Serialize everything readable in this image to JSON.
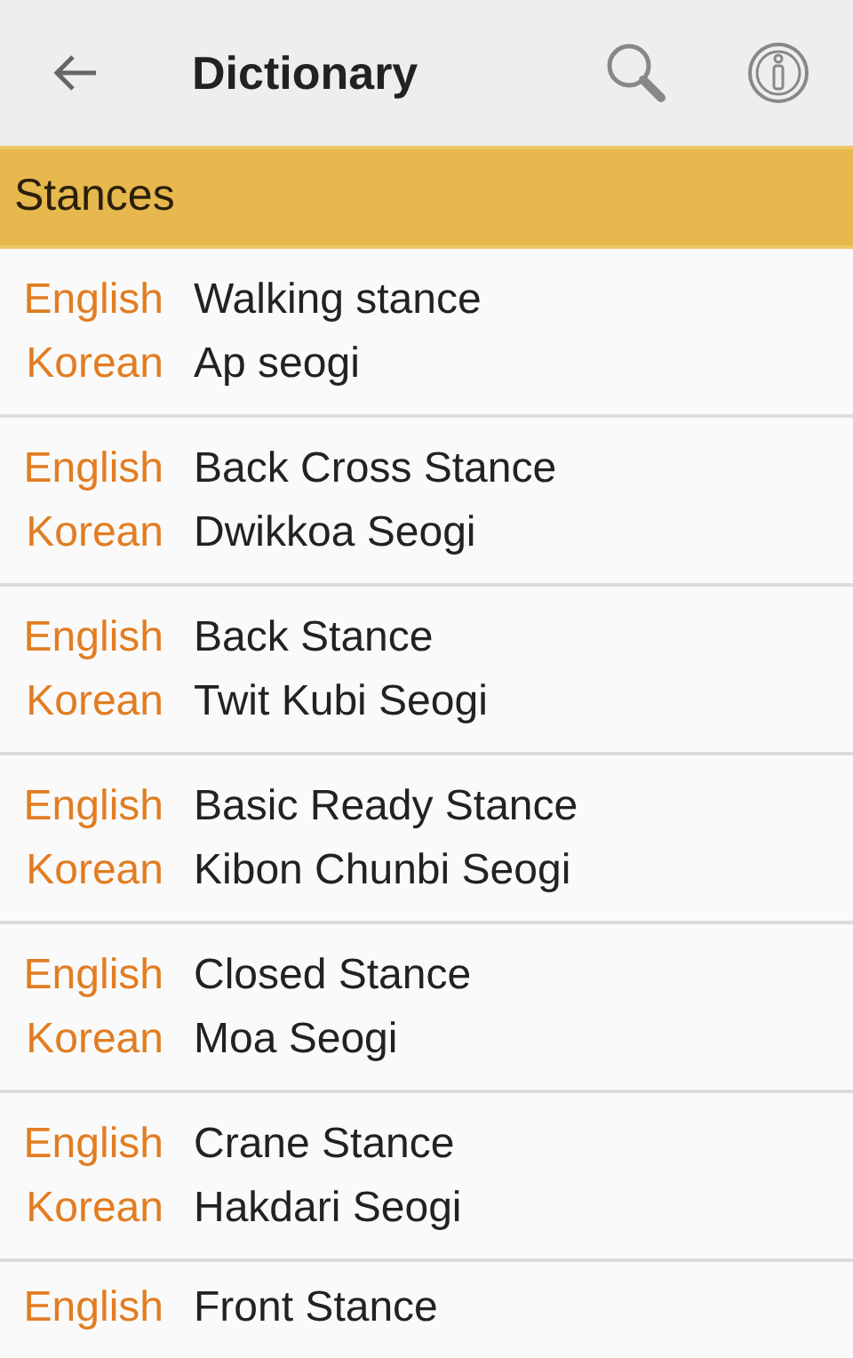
{
  "app_bar": {
    "title": "Dictionary"
  },
  "section": {
    "title": "Stances"
  },
  "entries": [
    {
      "english_label": "English",
      "english": "Walking stance",
      "korean_label": "Korean",
      "korean": "Ap seogi"
    },
    {
      "english_label": "English",
      "english": "Back Cross Stance",
      "korean_label": "Korean",
      "korean": "Dwikkoa Seogi"
    },
    {
      "english_label": "English",
      "english": "Back Stance",
      "korean_label": "Korean",
      "korean": "Twit Kubi Seogi"
    },
    {
      "english_label": "English",
      "english": "Basic Ready Stance",
      "korean_label": "Korean",
      "korean": "Kibon Chunbi Seogi"
    },
    {
      "english_label": "English",
      "english": "Closed Stance",
      "korean_label": "Korean",
      "korean": "Moa Seogi"
    },
    {
      "english_label": "English",
      "english": "Crane Stance",
      "korean_label": "Korean",
      "korean": "Hakdari Seogi"
    },
    {
      "english_label": "English",
      "english": "Front Stance"
    }
  ]
}
